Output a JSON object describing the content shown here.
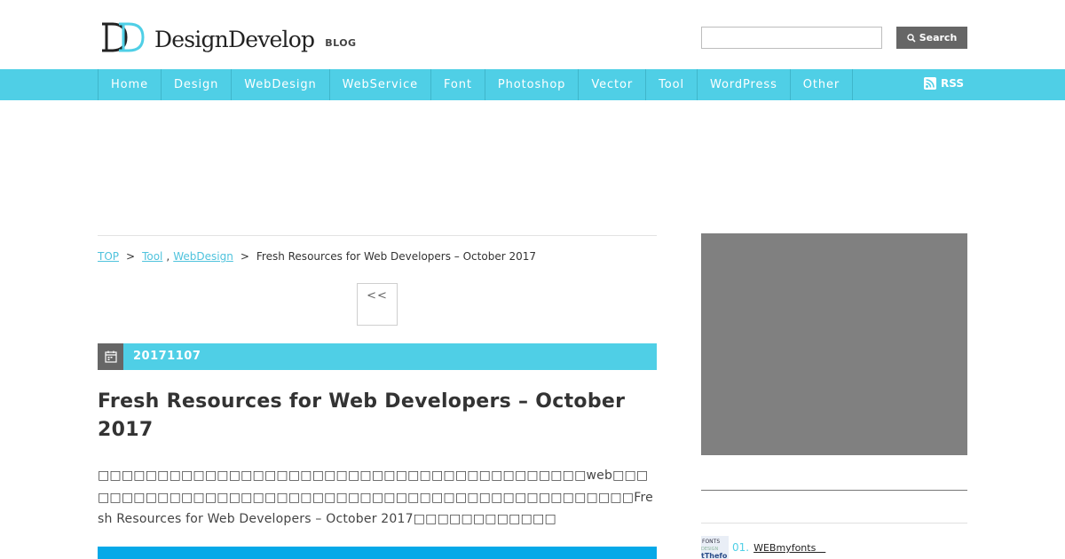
{
  "header": {
    "logo_text": "DesignDevelop",
    "logo_sub": "BLOG",
    "search_placeholder": "",
    "search_button": "Search"
  },
  "nav": {
    "items": [
      "Home",
      "Design",
      "WebDesign",
      "WebService",
      "Font",
      "Photoshop",
      "Vector",
      "Tool",
      "WordPress",
      "Other"
    ],
    "rss_label": "RSS"
  },
  "breadcrumb": {
    "top": "TOP",
    "sep": ">",
    "cat1": "Tool",
    "comma": ",",
    "cat2": "WebDesign",
    "current": "Fresh Resources for Web Developers – October 2017"
  },
  "pager": {
    "prev": "<<"
  },
  "post": {
    "date": "20171107",
    "title": "Fresh Resources for Web Developers – October 2017",
    "excerpt": "□□□□□□□□□□□□□□□□□□□□□□□□□□□□□□□□□□□□□□□□□web□□□□□□□□□□□□□□□□□□□□□□□□□□□□□□□□□□□□□□□□□□□□□□□□Fresh Resources for Web Developers – October 2017□□□□□□□□□□□□"
  },
  "sidebar": {
    "ranking": [
      {
        "num": "01.",
        "label": "WEBmyfonts　"
      }
    ],
    "thumb_text": "FONTS\ntThefo"
  },
  "colors": {
    "accent": "#4fcfe6",
    "nav_border": "#3fb6cb",
    "dark": "#666666",
    "blue_bar": "#05a9e8",
    "ad_gray": "#808080"
  }
}
